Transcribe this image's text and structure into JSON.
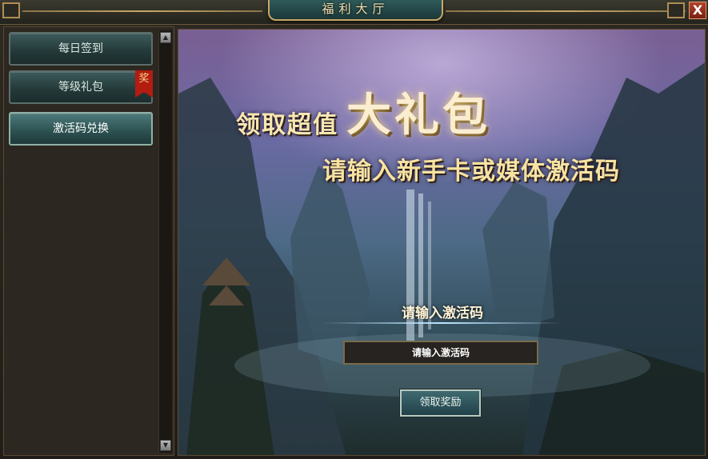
{
  "window": {
    "title": "福利大厅",
    "close_label": "X"
  },
  "sidebar": {
    "items": [
      {
        "label": "每日签到",
        "active": false
      },
      {
        "label": "等级礼包",
        "active": false,
        "badge": "奖"
      },
      {
        "label": "激活码兑换",
        "active": true
      }
    ],
    "scroll_up": "▲",
    "scroll_down": "▼"
  },
  "banner": {
    "headline_prefix": "领取超值",
    "headline_main": "大礼包",
    "subheadline": "请输入新手卡或媒体激活码"
  },
  "form": {
    "label": "请输入激活码",
    "input_placeholder": "请输入激活码",
    "input_value": "",
    "submit_label": "领取奖励"
  },
  "colors": {
    "accent_gold": "#c9a865",
    "tab_teal": "#2c5050",
    "badge_red": "#b31c10"
  }
}
